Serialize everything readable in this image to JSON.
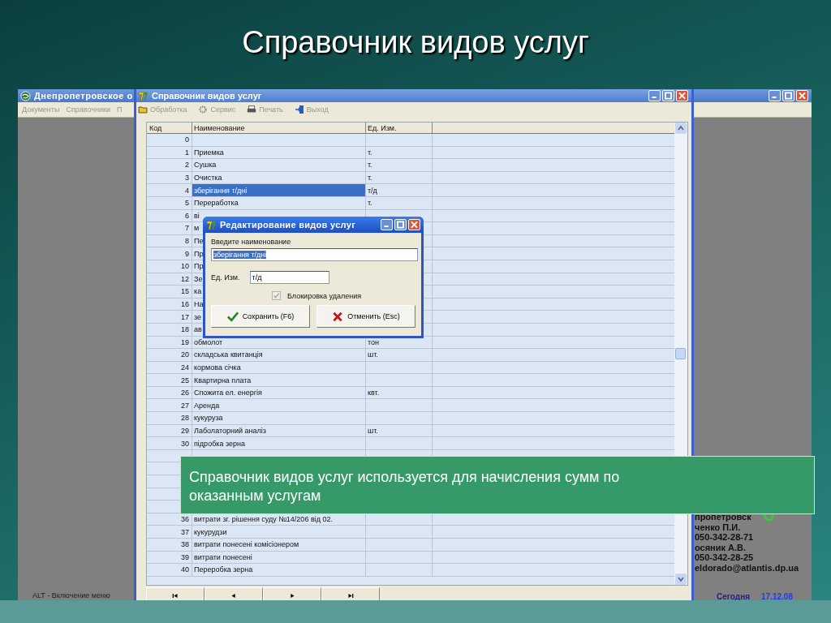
{
  "slide": {
    "title": "Справочник видов услуг",
    "note": "Справочник видов услуг используется для начисления сумм по оказанным услугам"
  },
  "main_window": {
    "title": "Днепропетровское о",
    "menu": [
      "Документы",
      "Справочники",
      "П"
    ],
    "hint": "ALT - Включение меню",
    "contact_lines": [
      "пропетровск",
      "ченко П.И.",
      "050-342-28-71",
      "осяник А.В.",
      "050-342-28-25",
      "eldorado@atlantis.dp.ua"
    ],
    "today_label": "Сегодня",
    "today_date": "17.12.08"
  },
  "window": {
    "title": "Справочник видов услуг",
    "toolbar": [
      {
        "kind": "folder",
        "label": "Обработка"
      },
      {
        "kind": "gear",
        "label": "Сервис"
      },
      {
        "kind": "printer",
        "label": "Печать"
      },
      {
        "kind": "exit",
        "label": "Выход"
      }
    ],
    "table": {
      "columns": [
        "Код",
        "Наименование",
        "Ед. Изм."
      ],
      "rows": [
        {
          "code": "0",
          "selected": false
        },
        {
          "code": "1",
          "name": "Приемка",
          "unit": "т.",
          "selected": false
        },
        {
          "code": "2",
          "name": "Сушка",
          "unit": "т.",
          "selected": false
        },
        {
          "code": "3",
          "name": "Очистка",
          "unit": "т.",
          "selected": false
        },
        {
          "code": "4",
          "name": "зберігання т/дні",
          "unit": "т/д",
          "selected": true
        },
        {
          "code": "5",
          "name": "Переработка",
          "unit": "т.",
          "selected": false
        },
        {
          "code": "6",
          "name": "ві",
          "selected": false
        },
        {
          "code": "7",
          "name": "м",
          "selected": false
        },
        {
          "code": "8",
          "name": "Пе",
          "selected": false
        },
        {
          "code": "9",
          "name": "Пр",
          "selected": false
        },
        {
          "code": "10",
          "name": "Пр",
          "selected": false
        },
        {
          "code": "12",
          "name": "Зе",
          "selected": false
        },
        {
          "code": "15",
          "name": "ка",
          "selected": false
        },
        {
          "code": "16",
          "name": "На",
          "selected": false
        },
        {
          "code": "17",
          "name": "зе",
          "selected": false
        },
        {
          "code": "18",
          "name": "ав",
          "selected": false
        },
        {
          "code": "19",
          "name": "обмолот",
          "unit": "тон",
          "selected": false
        },
        {
          "code": "20",
          "name": "складська квитанція",
          "unit": "шт.",
          "selected": false
        },
        {
          "code": "24",
          "name": "кормова січка",
          "selected": false
        },
        {
          "code": "25",
          "name": "Квартирна плата",
          "selected": false
        },
        {
          "code": "26",
          "name": "Спожита ел. енергія",
          "unit": "квт.",
          "selected": false
        },
        {
          "code": "27",
          "name": "Аренда",
          "selected": false
        },
        {
          "code": "28",
          "name": "кукуруза",
          "selected": false
        },
        {
          "code": "29",
          "name": "Лаболаторний аналіз",
          "unit": "шт.",
          "selected": false
        },
        {
          "code": "30",
          "name": "підробка зерна",
          "selected": false
        },
        {
          "kind": "hidden_block"
        },
        {
          "code": "36",
          "name": "витрати зг. рішення суду №14/206 від 02.",
          "selected": false
        },
        {
          "code": "37",
          "name": "кукурудзи",
          "selected": false
        },
        {
          "code": "38",
          "name": "витрати понесені комісіонером",
          "selected": false
        },
        {
          "code": "39",
          "name": "витрати понесені",
          "selected": false
        },
        {
          "code": "40",
          "name": "Переробка зерна",
          "selected": false
        }
      ]
    }
  },
  "dialog": {
    "title": "Редактирование видов услуг",
    "name_label": "Введите наименование",
    "name_value": "зберігання т/дні",
    "unit_label": "Ед. Изм.",
    "unit_value": "т/д",
    "checkbox": {
      "label": "Блокировка удаления",
      "checked": true,
      "disabled": true
    },
    "buttons": [
      {
        "kind": "save",
        "label": "Сохранить (F6)"
      },
      {
        "kind": "cancel",
        "label": "Отменить (Esc)"
      }
    ]
  }
}
